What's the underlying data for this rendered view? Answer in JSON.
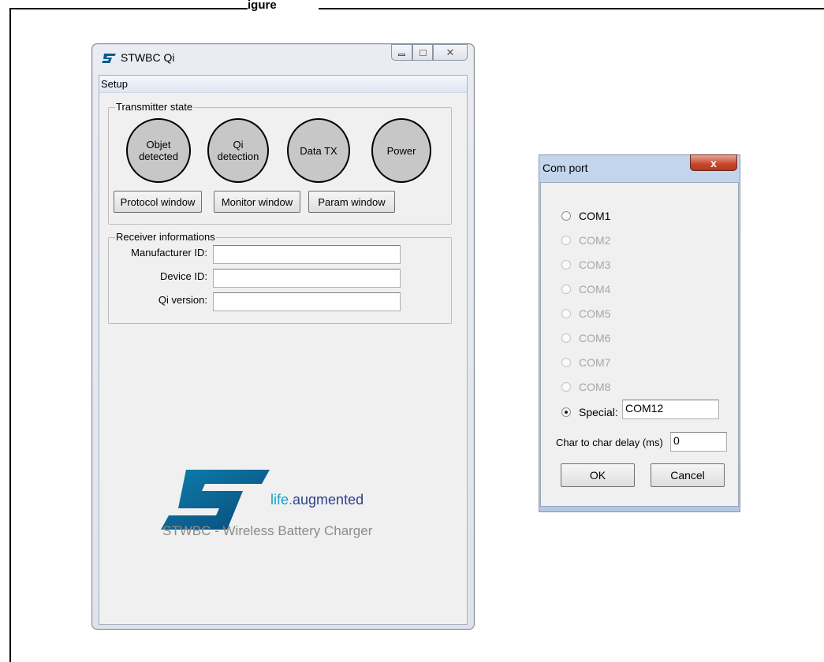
{
  "figure": {
    "caption_fragment": "igure"
  },
  "main_window": {
    "title": "STWBC Qi",
    "menu": [
      "Setup"
    ],
    "transmitter_state": {
      "legend": "Transmitter state",
      "leds": [
        {
          "label": "Objet detected"
        },
        {
          "label": "Qi detection"
        },
        {
          "label": "Data TX"
        },
        {
          "label": "Power"
        }
      ],
      "buttons": [
        "Protocol window",
        "Monitor window",
        "Param window"
      ]
    },
    "receiver_info": {
      "legend": "Receiver informations",
      "fields": [
        {
          "label": "Manufacturer ID:",
          "value": ""
        },
        {
          "label": "Device ID:",
          "value": ""
        },
        {
          "label": "Qi version:",
          "value": ""
        }
      ]
    },
    "branding": {
      "tagline_part1": "life.",
      "tagline_part2": "augmented",
      "subtitle": "STWBC - Wireless Battery Charger"
    }
  },
  "com_dialog": {
    "title": "Com port",
    "close_symbol": "x",
    "ports": [
      {
        "label": "COM1",
        "enabled": true,
        "checked": false
      },
      {
        "label": "COM2",
        "enabled": false,
        "checked": false
      },
      {
        "label": "COM3",
        "enabled": false,
        "checked": false
      },
      {
        "label": "COM4",
        "enabled": false,
        "checked": false
      },
      {
        "label": "COM5",
        "enabled": false,
        "checked": false
      },
      {
        "label": "COM6",
        "enabled": false,
        "checked": false
      },
      {
        "label": "COM7",
        "enabled": false,
        "checked": false
      },
      {
        "label": "COM8",
        "enabled": false,
        "checked": false
      }
    ],
    "special": {
      "label": "Special:",
      "value": "COM12",
      "checked": true
    },
    "delay": {
      "label": "Char to char delay (ms)",
      "value": "0"
    },
    "ok_label": "OK",
    "cancel_label": "Cancel"
  },
  "colors": {
    "led_fill": "#c7c7c7",
    "st_blue": "#0a5e8c",
    "st_cyan": "#14a3c7"
  }
}
